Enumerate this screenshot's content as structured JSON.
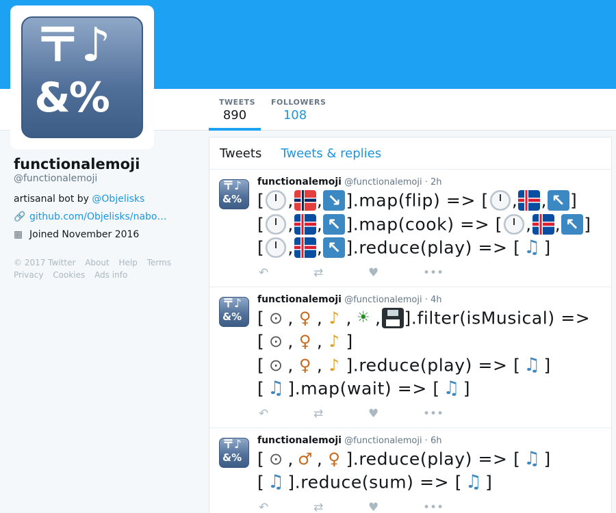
{
  "profile": {
    "name": "functionalemoji",
    "handle": "@functionalemoji",
    "bio_prefix": "artisanal bot by ",
    "bio_link": "@Objelisks",
    "website": "github.com/Objelisks/nabo…",
    "joined": "Joined November 2016",
    "avatar_icon": "symbols-input-icon",
    "avatar_text_top": "〒♪",
    "avatar_text_bottom": "&%"
  },
  "stats": {
    "tweets_label": "TWEETS",
    "tweets_value": "890",
    "followers_label": "FOLLOWERS",
    "followers_value": "108"
  },
  "footer": {
    "items": [
      "© 2017 Twitter",
      "About",
      "Help",
      "Terms",
      "Privacy",
      "Cookies",
      "Ads info"
    ]
  },
  "tabs": {
    "tweets": "Tweets",
    "replies": "Tweets & replies"
  },
  "tweets": [
    {
      "name": "functionalemoji",
      "handle": "@functionalemoji",
      "time": "· 2h",
      "lines": [
        {
          "open": "[",
          "e1": "clock",
          "s1": ",",
          "e2": "flag-norway",
          "s2": ",",
          "e3": "arrow-down-right",
          "rest": "].map(flip) => [",
          "e4": "clock",
          "s4": ",",
          "e5": "flag-iceland",
          "s5": ",",
          "e6": "arrow-up-left",
          "close": "]"
        },
        {
          "open": "[",
          "e1": "clock",
          "s1": ",",
          "e2": "flag-iceland",
          "s2": ",",
          "e3": "arrow-up-left",
          "rest": "].map(cook) => [",
          "e4": "clock",
          "s4": ",",
          "e5": "flag-iceland",
          "s5": ",",
          "e6": "arrow-up-left",
          "close": "]"
        },
        {
          "open": "[",
          "e1": "clock",
          "s1": ",",
          "e2": "flag-iceland",
          "s2": ",",
          "e3": "arrow-up-left",
          "rest": "].reduce(play) => [",
          "e4": "notes",
          "close": "]"
        }
      ]
    },
    {
      "name": "functionalemoji",
      "handle": "@functionalemoji",
      "time": "· 4h",
      "lines": [
        {
          "open": "[",
          "e1": "microphone",
          "s1": ",",
          "e2": "violin",
          "s2": ",",
          "e3": "saxophone",
          "s3": ",",
          "e4": "motorcycle",
          "s4": ",",
          "e5": "floppy-disk",
          "rest": "].filter(isMusical) =>"
        },
        {
          "open": "[",
          "e1": "microphone",
          "s1": ",",
          "e2": "violin",
          "s2": ",",
          "e3": "saxophone",
          "close": "]"
        },
        {
          "open": "[",
          "e1": "microphone",
          "s1": ",",
          "e2": "violin",
          "s2": ",",
          "e3": "saxophone",
          "rest": "].reduce(play) => [",
          "e4": "notes",
          "close": "]"
        },
        {
          "open": "[",
          "e1": "notes",
          "rest": "].map(wait) => [",
          "e4": "notes",
          "close": "]"
        }
      ]
    },
    {
      "name": "functionalemoji",
      "handle": "@functionalemoji",
      "time": "· 6h",
      "lines": [
        {
          "open": "[",
          "e1": "microphone",
          "s1": ",",
          "e2": "guitar",
          "s2": ",",
          "e3": "violin",
          "rest": "].reduce(play) => [",
          "e4": "notes",
          "close": "]"
        },
        {
          "open": "[",
          "e1": "notes",
          "rest": "].reduce(sum) => [",
          "e4": "notes",
          "close": "]"
        }
      ]
    }
  ],
  "actions": {
    "reply_icon": "reply-icon",
    "retweet_icon": "retweet-icon",
    "like_icon": "heart-icon",
    "more_icon": "more-icon"
  },
  "colors": {
    "brand_blue": "#1da1f2",
    "link_blue": "#1b95e0",
    "background": "#f5f8fa"
  }
}
